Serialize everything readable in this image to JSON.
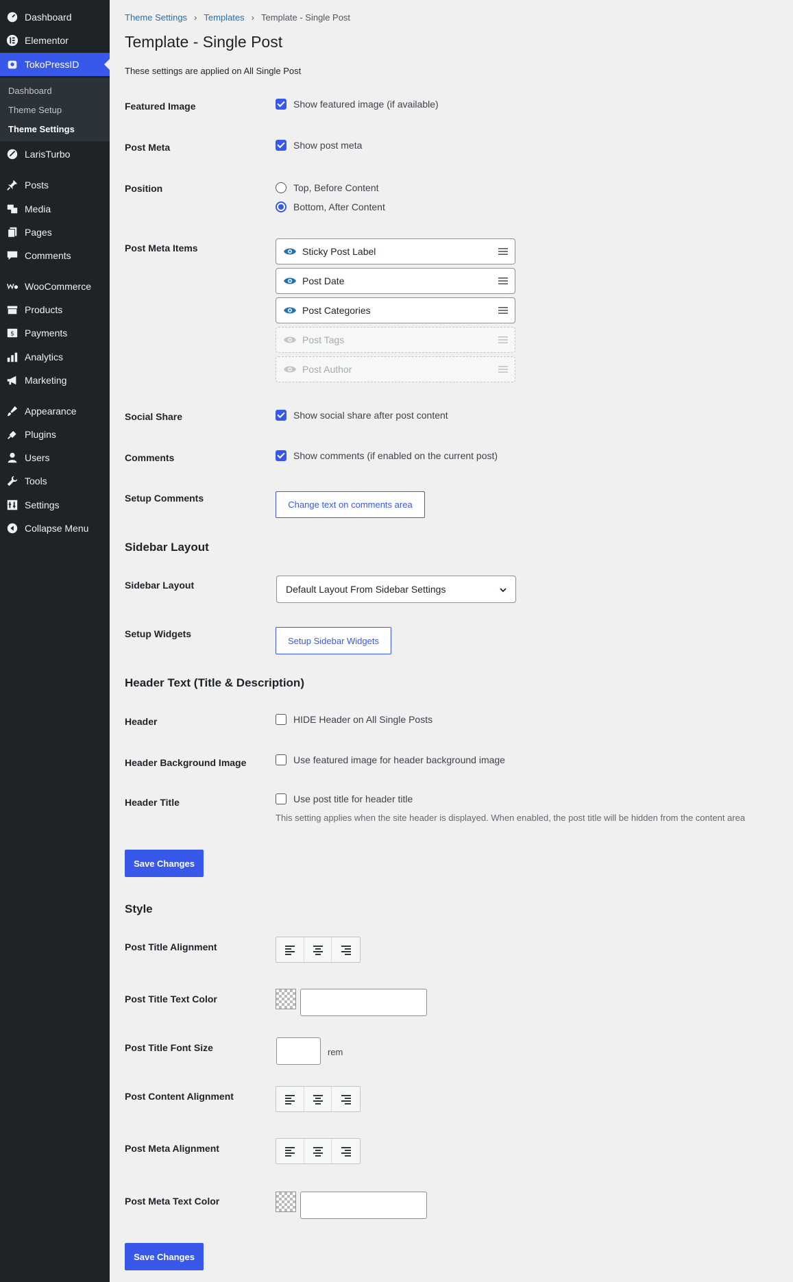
{
  "sidebar": {
    "items": [
      {
        "label": "Dashboard",
        "icon": "dashboard-icon"
      },
      {
        "label": "Elementor",
        "icon": "elementor-icon"
      },
      {
        "label": "TokoPressID",
        "icon": "tokopress-icon"
      },
      {
        "label": "LarisTurbo",
        "icon": "laristurbo-icon"
      },
      {
        "label": "Posts",
        "icon": "pin-icon"
      },
      {
        "label": "Media",
        "icon": "media-icon"
      },
      {
        "label": "Pages",
        "icon": "pages-icon"
      },
      {
        "label": "Comments",
        "icon": "comment-icon"
      },
      {
        "label": "WooCommerce",
        "icon": "woocommerce-icon"
      },
      {
        "label": "Products",
        "icon": "products-icon"
      },
      {
        "label": "Payments",
        "icon": "payments-icon"
      },
      {
        "label": "Analytics",
        "icon": "analytics-icon"
      },
      {
        "label": "Marketing",
        "icon": "megaphone-icon"
      },
      {
        "label": "Appearance",
        "icon": "brush-icon"
      },
      {
        "label": "Plugins",
        "icon": "plugin-icon"
      },
      {
        "label": "Users",
        "icon": "user-icon"
      },
      {
        "label": "Tools",
        "icon": "wrench-icon"
      },
      {
        "label": "Settings",
        "icon": "settings-icon"
      },
      {
        "label": "Collapse Menu",
        "icon": "collapse-icon"
      }
    ],
    "submenu": [
      "Dashboard",
      "Theme Setup",
      "Theme Settings"
    ]
  },
  "breadcrumb": {
    "first": "Theme Settings",
    "second": "Templates",
    "current": "Template - Single Post"
  },
  "page": {
    "title": "Template - Single Post",
    "description": "These settings are applied on All Single Post"
  },
  "fields": {
    "featured_image": {
      "label": "Featured Image",
      "option": "Show featured image (if available)"
    },
    "post_meta": {
      "label": "Post Meta",
      "option": "Show post meta"
    },
    "position": {
      "label": "Position",
      "option_top": "Top, Before Content",
      "option_bottom": "Bottom, After Content"
    },
    "meta_items": {
      "label": "Post Meta Items",
      "items": [
        "Sticky Post Label",
        "Post Date",
        "Post Categories",
        "Post Tags",
        "Post Author"
      ]
    },
    "social_share": {
      "label": "Social Share",
      "option": "Show social share after post content"
    },
    "comments": {
      "label": "Comments",
      "option": "Show comments (if enabled on the current post)"
    },
    "setup_comments": {
      "label": "Setup Comments",
      "button": "Change text on comments area"
    }
  },
  "sidebar_layout": {
    "section": "Sidebar Layout",
    "label": "Sidebar Layout",
    "selected": "Default Layout From Sidebar Settings",
    "widgets_label": "Setup Widgets",
    "widgets_button": "Setup Sidebar Widgets"
  },
  "header_text": {
    "section": "Header Text (Title & Description)",
    "header_label": "Header",
    "header_option": "HIDE Header on All Single Posts",
    "bg_label": "Header Background Image",
    "bg_option": "Use featured image for header background image",
    "title_label": "Header Title",
    "title_option": "Use post title for header title",
    "help": "This setting applies when the site header is displayed. When enabled, the post title will be hidden from the content area"
  },
  "save_label": "Save Changes",
  "style": {
    "section": "Style",
    "title_alignment": "Post Title Alignment",
    "title_color": "Post Title Text Color",
    "title_font_size": "Post Title Font Size",
    "unit": "rem",
    "content_alignment": "Post Content Alignment",
    "meta_alignment": "Post Meta Alignment",
    "meta_color": "Post Meta Text Color"
  },
  "colors": {
    "accent": "#3858e9",
    "sidebar_bg": "#1d2327",
    "link": "#2271b1"
  }
}
